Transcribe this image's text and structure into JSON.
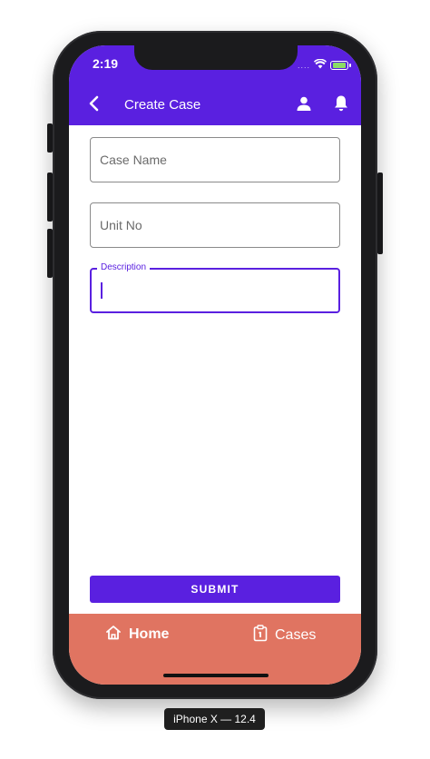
{
  "status_bar": {
    "time": "2:19",
    "signal": "....",
    "battery_color": "#8bdc64"
  },
  "appbar": {
    "title": "Create Case",
    "back_icon": "chevron-left-icon",
    "profile_icon": "user-icon",
    "notification_icon": "bell-icon",
    "color": "#5a20e0"
  },
  "form": {
    "case_name": {
      "placeholder": "Case Name",
      "value": ""
    },
    "unit_no": {
      "placeholder": "Unit No",
      "value": ""
    },
    "description": {
      "label": "Description",
      "value": "",
      "focused": true
    }
  },
  "submit": {
    "label": "SUBMIT"
  },
  "bottom_nav": {
    "color": "#e07461",
    "items": [
      {
        "label": "Home",
        "icon": "home-icon",
        "active": true
      },
      {
        "label": "Cases",
        "icon": "clipboard-icon",
        "active": false
      }
    ]
  },
  "device_label": "iPhone X — 12.4"
}
